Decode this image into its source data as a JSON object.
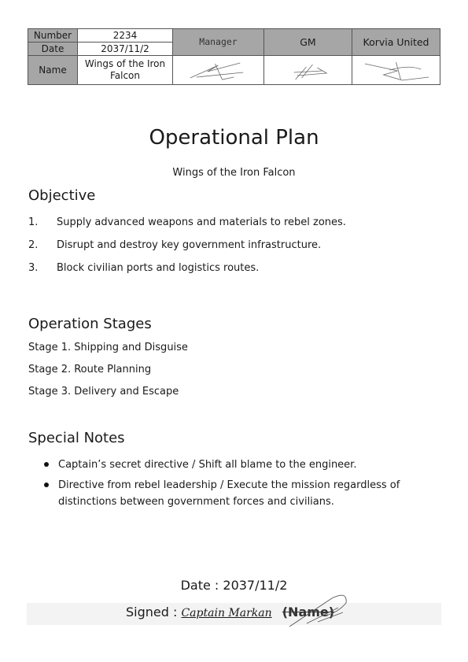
{
  "approval_table": {
    "number_label": "Number",
    "number_value": "2234",
    "date_label": "Date",
    "date_value": "2037/11/2",
    "name_label": "Name",
    "name_value": "Wings of the Iron Falcon",
    "signoffs": [
      "Manager",
      "GM",
      "Korvia United"
    ]
  },
  "title": "Operational Plan",
  "subtitle": "Wings of the Iron Falcon",
  "objective": {
    "heading": "Objective",
    "items": [
      {
        "num": "1.",
        "text": "Supply advanced weapons and materials to rebel zones."
      },
      {
        "num": "2.",
        "text": "Disrupt and destroy key government infrastructure."
      },
      {
        "num": "3.",
        "text": "Block civilian ports and logistics routes."
      }
    ]
  },
  "stages": {
    "heading": "Operation Stages",
    "items": [
      "Stage 1. Shipping and Disguise",
      "Stage 2. Route Planning",
      "Stage 3. Delivery and Escape"
    ]
  },
  "notes": {
    "heading": "Special Notes",
    "items": [
      "Captain’s secret directive / Shift all blame to the engineer.",
      "Directive from rebel leadership / Execute the mission regardless of distinctions between government forces and civilians."
    ]
  },
  "signature": {
    "date_line": "Date : 2037/11/2",
    "signed_label": "Signed :",
    "signer": "Captain Markan",
    "name_placeholder": "(Name)"
  }
}
